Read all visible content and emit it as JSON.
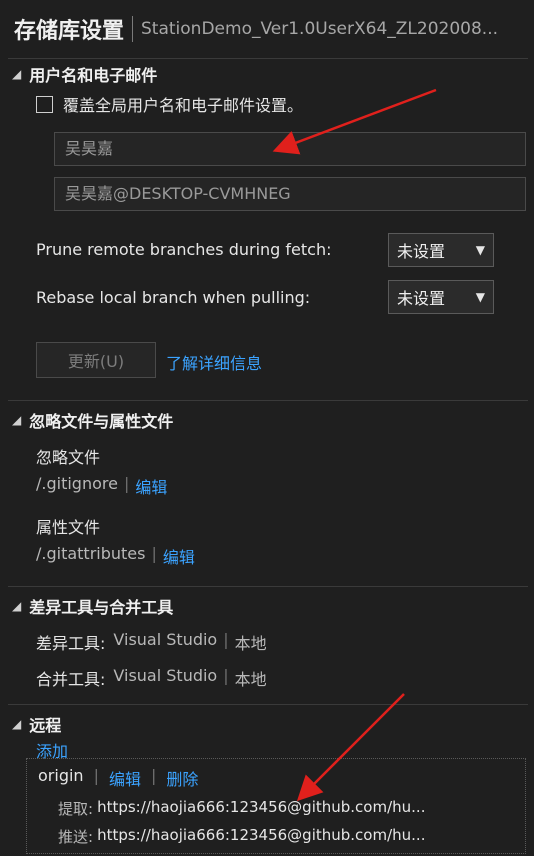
{
  "window": {
    "title": "存储库设置",
    "subtitle": "StationDemo_Ver1.0UserX64_ZL202008..."
  },
  "sections": {
    "user": {
      "header": "用户名和电子邮件",
      "override_label": "覆盖全局用户名和电子邮件设置。",
      "name_value": "吴昊嘉",
      "email_value": "吴昊嘉@DESKTOP-CVMHNEG",
      "prune_label": "Prune remote branches during fetch:",
      "prune_value": "未设置",
      "rebase_label": "Rebase local branch when pulling:",
      "rebase_value": "未设置",
      "update_button": "更新(U)",
      "learn_more": "了解详细信息"
    },
    "ignore": {
      "header": "忽略文件与属性文件",
      "ignore_title": "忽略文件",
      "ignore_file": "/.gitignore",
      "ignore_edit": "编辑",
      "attr_title": "属性文件",
      "attr_file": "/.gitattributes",
      "attr_edit": "编辑"
    },
    "tools": {
      "header": "差异工具与合并工具",
      "diff_label": "差异工具:",
      "diff_tool": "Visual Studio",
      "diff_scope": "本地",
      "merge_label": "合并工具:",
      "merge_tool": "Visual Studio",
      "merge_scope": "本地"
    },
    "remote": {
      "header": "远程",
      "add": "添加",
      "name": "origin",
      "edit": "编辑",
      "delete": "删除",
      "fetch_label": "提取:",
      "fetch_url": "https://haojia666:123456@github.com/hu...",
      "push_label": "推送:",
      "push_url": "https://haojia666:123456@github.com/hu..."
    }
  },
  "colors": {
    "background": "#1f1f1f",
    "link": "#3ba3ff",
    "annotation_arrow": "#e0201c"
  },
  "icons": {
    "section_toggle": "collapse-triangle-icon",
    "dropdown": "chevron-down-icon"
  }
}
